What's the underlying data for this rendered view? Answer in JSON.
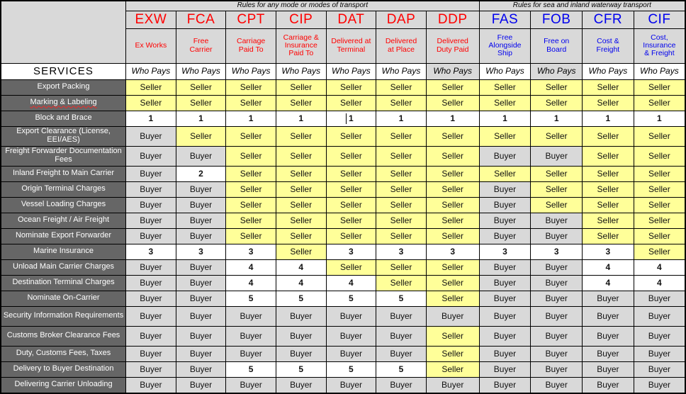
{
  "title": "Incoterms Responsibility Chart",
  "groups": {
    "any_mode": "Rules for any mode or modes of transport",
    "sea": "Rules for sea and inland waterway transport"
  },
  "colors": {
    "any_mode_text": "#ff0000",
    "sea_text": "#0000ee",
    "seller_cell": "#ffff99",
    "buyer_cell": "#d9d9d9",
    "number_cell": "#ffffff",
    "service_label_bg": "#666666",
    "header_bg": "#d9d9d9"
  },
  "services_header": "SERVICES",
  "who_pays_label": "Who Pays",
  "terms": [
    {
      "code": "EXW",
      "name": "Ex Works",
      "group": "any",
      "who_pays_shaded": false
    },
    {
      "code": "FCA",
      "name": "Free\nCarrier",
      "group": "any",
      "who_pays_shaded": false
    },
    {
      "code": "CPT",
      "name": "Carriage\nPaid To",
      "group": "any",
      "who_pays_shaded": false
    },
    {
      "code": "CIP",
      "name": "Carriage &\nInsurance\nPaid To",
      "group": "any",
      "who_pays_shaded": false
    },
    {
      "code": "DAT",
      "name": "Delivered at\nTerminal",
      "group": "any",
      "who_pays_shaded": false
    },
    {
      "code": "DAP",
      "name": "Delivered\nat Place",
      "group": "any",
      "who_pays_shaded": false
    },
    {
      "code": "DDP",
      "name": "Delivered\nDuty Paid",
      "group": "any",
      "who_pays_shaded": true
    },
    {
      "code": "FAS",
      "name": "Free\nAlongside\nShip",
      "group": "sea",
      "who_pays_shaded": false
    },
    {
      "code": "FOB",
      "name": "Free on\nBoard",
      "group": "sea",
      "who_pays_shaded": true
    },
    {
      "code": "CFR",
      "name": "Cost &\nFreight",
      "group": "sea",
      "who_pays_shaded": false
    },
    {
      "code": "CIF",
      "name": "Cost,\nInsurance\n& Freight",
      "group": "sea",
      "who_pays_shaded": false
    }
  ],
  "rows": [
    {
      "service": "Export Packing",
      "tall": false,
      "spell": false,
      "values": [
        "Seller",
        "Seller",
        "Seller",
        "Seller",
        "Seller",
        "Seller",
        "Seller",
        "Seller",
        "Seller",
        "Seller",
        "Seller"
      ]
    },
    {
      "service": "Marking & Labeling",
      "tall": false,
      "spell": true,
      "values": [
        "Seller",
        "Seller",
        "Seller",
        "Seller",
        "Seller",
        "Seller",
        "Seller",
        "Seller",
        "Seller",
        "Seller",
        "Seller"
      ]
    },
    {
      "service": "Block and Brace",
      "tall": false,
      "spell": false,
      "values": [
        "1",
        "1",
        "1",
        "1",
        "1",
        "1",
        "1",
        "1",
        "1",
        "1",
        "1"
      ]
    },
    {
      "service": "Export Clearance (License, EEI/AES)",
      "tall": true,
      "spell": false,
      "values": [
        "Buyer",
        "Seller",
        "Seller",
        "Seller",
        "Seller",
        "Seller",
        "Seller",
        "Seller",
        "Seller",
        "Seller",
        "Seller"
      ]
    },
    {
      "service": "Freight Forwarder Documentation Fees",
      "tall": true,
      "spell": false,
      "values": [
        "Buyer",
        "Buyer",
        "Seller",
        "Seller",
        "Seller",
        "Seller",
        "Seller",
        "Buyer",
        "Buyer",
        "Seller",
        "Seller"
      ]
    },
    {
      "service": "Inland Freight to Main Carrier",
      "tall": false,
      "spell": false,
      "values": [
        "Buyer",
        "2",
        "Seller",
        "Seller",
        "Seller",
        "Seller",
        "Seller",
        "Seller",
        "Seller",
        "Seller",
        "Seller"
      ]
    },
    {
      "service": "Origin Terminal Charges",
      "tall": false,
      "spell": false,
      "values": [
        "Buyer",
        "Buyer",
        "Seller",
        "Seller",
        "Seller",
        "Seller",
        "Seller",
        "Buyer",
        "Seller",
        "Seller",
        "Seller"
      ]
    },
    {
      "service": "Vessel Loading Charges",
      "tall": false,
      "spell": false,
      "values": [
        "Buyer",
        "Buyer",
        "Seller",
        "Seller",
        "Seller",
        "Seller",
        "Seller",
        "Buyer",
        "Seller",
        "Seller",
        "Seller"
      ]
    },
    {
      "service": "Ocean Freight / Air Freight",
      "tall": false,
      "spell": false,
      "values": [
        "Buyer",
        "Buyer",
        "Seller",
        "Seller",
        "Seller",
        "Seller",
        "Seller",
        "Buyer",
        "Buyer",
        "Seller",
        "Seller"
      ]
    },
    {
      "service": "Nominate Export Forwarder",
      "tall": false,
      "spell": false,
      "values": [
        "Buyer",
        "Buyer",
        "Seller",
        "Seller",
        "Seller",
        "Seller",
        "Seller",
        "Buyer",
        "Buyer",
        "Seller",
        "Seller"
      ]
    },
    {
      "service": "Marine Insurance",
      "tall": false,
      "spell": false,
      "values": [
        "3",
        "3",
        "3",
        "Seller",
        "3",
        "3",
        "3",
        "3",
        "3",
        "3",
        "Seller"
      ]
    },
    {
      "service": "Unload Main Carrier Charges",
      "tall": false,
      "spell": false,
      "values": [
        "Buyer",
        "Buyer",
        "4",
        "4",
        "Seller",
        "Seller",
        "Seller",
        "Buyer",
        "Buyer",
        "4",
        "4"
      ]
    },
    {
      "service": "Destination Terminal Charges",
      "tall": false,
      "spell": false,
      "values": [
        "Buyer",
        "Buyer",
        "4",
        "4",
        "4",
        "Seller",
        "Seller",
        "Buyer",
        "Buyer",
        "4",
        "4"
      ]
    },
    {
      "service": "Nominate On-Carrier",
      "tall": false,
      "spell": false,
      "values": [
        "Buyer",
        "Buyer",
        "5",
        "5",
        "5",
        "5",
        "Seller",
        "Buyer",
        "Buyer",
        "Buyer",
        "Buyer"
      ]
    },
    {
      "service": "Security Information Requirements",
      "tall": true,
      "spell": false,
      "values": [
        "Buyer",
        "Buyer",
        "Buyer",
        "Buyer",
        "Buyer",
        "Buyer",
        "Buyer",
        "Buyer",
        "Buyer",
        "Buyer",
        "Buyer"
      ]
    },
    {
      "service": "Customs Broker Clearance Fees",
      "tall": true,
      "spell": false,
      "values": [
        "Buyer",
        "Buyer",
        "Buyer",
        "Buyer",
        "Buyer",
        "Buyer",
        "Seller",
        "Buyer",
        "Buyer",
        "Buyer",
        "Buyer"
      ]
    },
    {
      "service": "Duty, Customs Fees, Taxes",
      "tall": false,
      "spell": false,
      "values": [
        "Buyer",
        "Buyer",
        "Buyer",
        "Buyer",
        "Buyer",
        "Buyer",
        "Seller",
        "Buyer",
        "Buyer",
        "Buyer",
        "Buyer"
      ]
    },
    {
      "service": "Delivery to Buyer Destination",
      "tall": false,
      "spell": false,
      "values": [
        "Buyer",
        "Buyer",
        "5",
        "5",
        "5",
        "5",
        "Seller",
        "Buyer",
        "Buyer",
        "Buyer",
        "Buyer"
      ]
    },
    {
      "service": "Delivering Carrier Unloading",
      "tall": false,
      "spell": false,
      "values": [
        "Buyer",
        "Buyer",
        "Buyer",
        "Buyer",
        "Buyer",
        "Buyer",
        "Buyer",
        "Buyer",
        "Buyer",
        "Buyer",
        "Buyer"
      ]
    }
  ],
  "caret_cell": {
    "row": 2,
    "col": 4
  }
}
